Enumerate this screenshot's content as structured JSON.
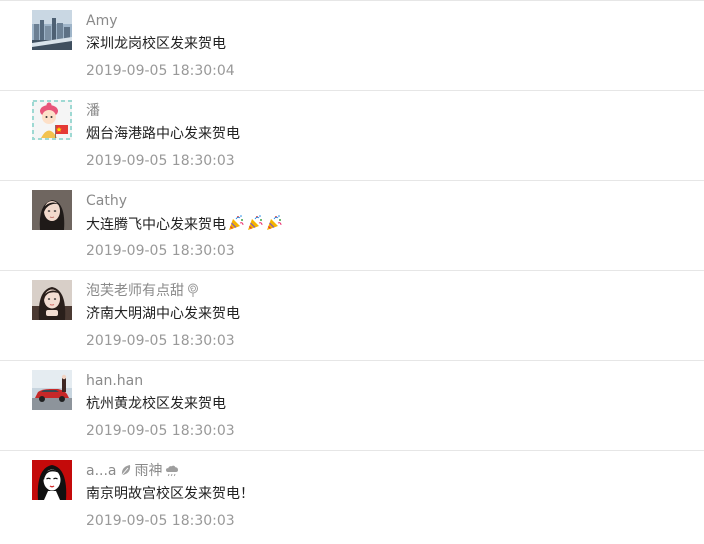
{
  "messages": [
    {
      "name": "Amy",
      "text": "深圳龙岗校区发来贺电",
      "time": "2019-09-05 18:30:04",
      "avatar_icon": "city-skyline-photo-icon"
    },
    {
      "name": "潘",
      "text": "烟台海港路中心发来贺电",
      "time": "2019-09-05 18:30:03",
      "avatar_icon": "cartoon-girl-with-flag-icon"
    },
    {
      "name": "Cathy",
      "text": "大连腾飞中心发来贺电",
      "time": "2019-09-05 18:30:03",
      "avatar_icon": "woman-portrait-photo-icon",
      "emojis": [
        "party-popper-icon",
        "party-popper-icon",
        "party-popper-icon"
      ]
    },
    {
      "name": "泡芙老师有点甜",
      "text": "济南大明湖中心发来贺电",
      "time": "2019-09-05 18:30:03",
      "avatar_icon": "woman-portrait-photo-icon",
      "name_icon": "lollipop-icon"
    },
    {
      "name": "han.han",
      "text": "杭州黄龙校区发来贺电",
      "time": "2019-09-05 18:30:03",
      "avatar_icon": "red-car-photo-icon"
    },
    {
      "name_prefix": "a...a",
      "name_suffix": "雨神",
      "text": "南京明故宫校区发来贺电！",
      "time": "2019-09-05 18:30:03",
      "avatar_icon": "red-illustration-girl-icon",
      "name_icons": [
        "leaf-icon",
        "rain-cloud-icon"
      ]
    }
  ],
  "colors": {
    "name": "#8a8a8a",
    "text": "#222222",
    "time": "#999999",
    "divider": "#e6e6e6"
  }
}
